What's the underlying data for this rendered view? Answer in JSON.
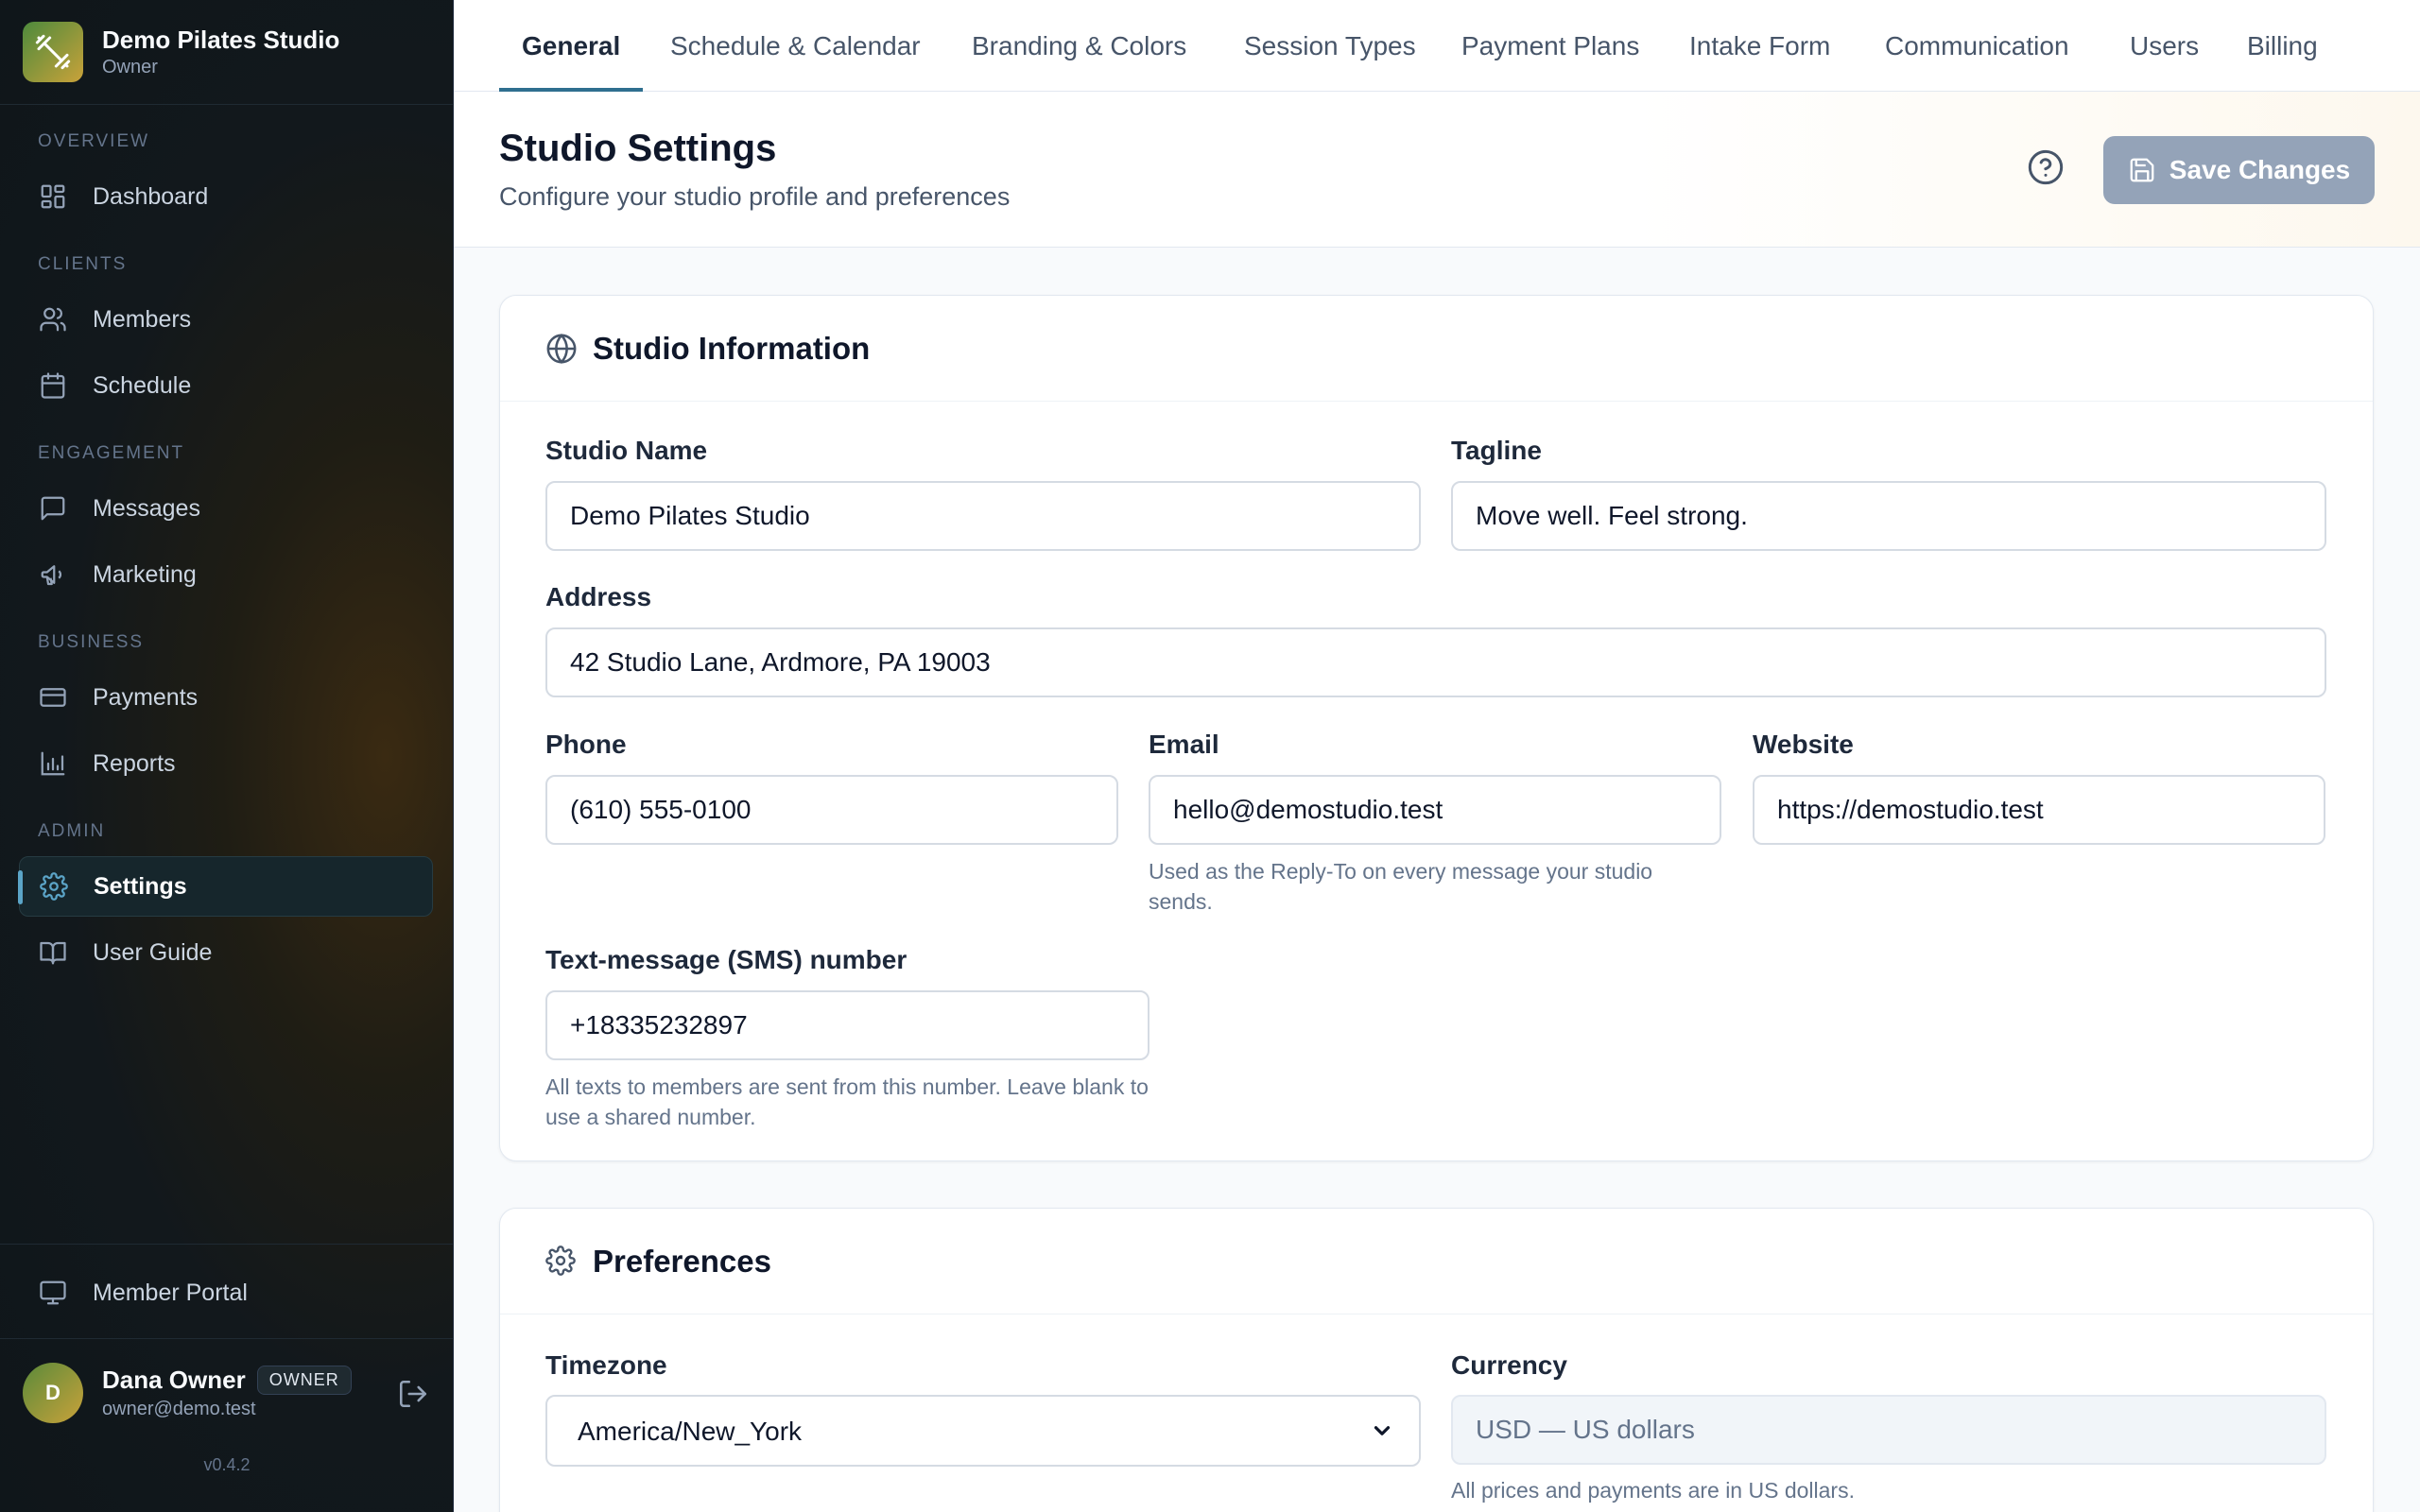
{
  "sidebar": {
    "brand_name": "Demo Pilates Studio",
    "brand_role": "Owner",
    "sections": {
      "overview": "OVERVIEW",
      "clients": "CLIENTS",
      "engagement": "ENGAGEMENT",
      "business": "BUSINESS",
      "admin": "ADMIN"
    },
    "items": {
      "dashboard": "Dashboard",
      "members": "Members",
      "schedule": "Schedule",
      "messages": "Messages",
      "marketing": "Marketing",
      "payments": "Payments",
      "reports": "Reports",
      "settings": "Settings",
      "user_guide": "User Guide",
      "member_portal": "Member Portal"
    },
    "active_item": "settings",
    "user": {
      "initial": "D",
      "name": "Dana Owner",
      "badge": "OWNER",
      "email": "owner@demo.test"
    },
    "version": "v0.4.2"
  },
  "tabs": [
    "General",
    "Schedule & Calendar",
    "Branding & Colors",
    "Session Types",
    "Payment Plans",
    "Intake Form",
    "Communication",
    "Users",
    "Billing"
  ],
  "active_tab": "General",
  "header": {
    "title": "Studio Settings",
    "subtitle": "Configure your studio profile and preferences",
    "save_label": "Save Changes"
  },
  "studio_info": {
    "title": "Studio Information",
    "studio_name_label": "Studio Name",
    "studio_name_value": "Demo Pilates Studio",
    "tagline_label": "Tagline",
    "tagline_value": "Move well. Feel strong.",
    "address_label": "Address",
    "address_value": "42 Studio Lane, Ardmore, PA 19003",
    "phone_label": "Phone",
    "phone_value": "(610) 555-0100",
    "email_label": "Email",
    "email_value": "hello@demostudio.test",
    "email_hint": "Used as the Reply-To on every message your studio sends.",
    "website_label": "Website",
    "website_value": "https://demostudio.test",
    "sms_label": "Text-message (SMS) number",
    "sms_value": "+18335232897",
    "sms_hint": "All texts to members are sent from this number. Leave blank to use a shared number."
  },
  "preferences": {
    "title": "Preferences",
    "timezone_label": "Timezone",
    "timezone_value": "America/New_York",
    "currency_label": "Currency",
    "currency_value": "USD — US dollars",
    "currency_hint": "All prices and payments are in US dollars."
  },
  "colors": {
    "accent": "#2f6f8f",
    "save_button_disabled": "#94a3b8",
    "sidebar_bg": "#0f161a"
  }
}
